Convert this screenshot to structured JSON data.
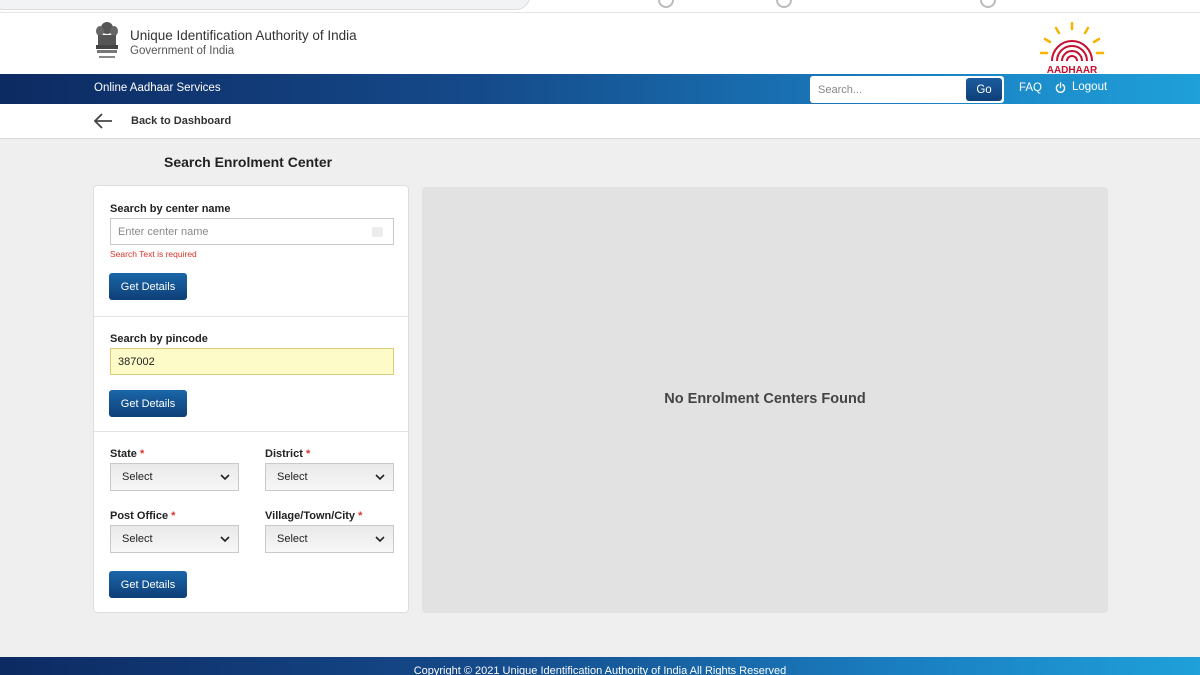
{
  "header": {
    "org_name": "Unique Identification Authority of India",
    "org_sub": "Government of India",
    "logo_text": "AADHAAR"
  },
  "nav": {
    "title": "Online Aadhaar Services",
    "search_placeholder": "Search...",
    "go_label": "Go",
    "faq_label": "FAQ",
    "logout_label": "Logout"
  },
  "back": {
    "label": "Back to Dashboard"
  },
  "page": {
    "title": "Search Enrolment Center"
  },
  "center_search": {
    "label": "Search by center name",
    "placeholder": "Enter center name",
    "error": "Search Text is required",
    "button": "Get Details"
  },
  "pincode_search": {
    "label": "Search by pincode",
    "value": "387002",
    "button": "Get Details"
  },
  "location_search": {
    "state_label": "State",
    "district_label": "District",
    "post_office_label": "Post Office",
    "village_label": "Village/Town/City",
    "required_marker": "*",
    "select_default": "Select",
    "button": "Get Details"
  },
  "results": {
    "message": "No Enrolment Centers Found"
  },
  "footer": {
    "text": "Copyright © 2021 Unique Identification Authority of India All Rights Reserved"
  },
  "colors": {
    "nav_dark": "#0d2a62",
    "nav_light": "#1fa0d8",
    "button": "#0e3f78",
    "error": "#d9342b",
    "aadhaar_red": "#c8102e",
    "aadhaar_yellow": "#f5b400"
  }
}
